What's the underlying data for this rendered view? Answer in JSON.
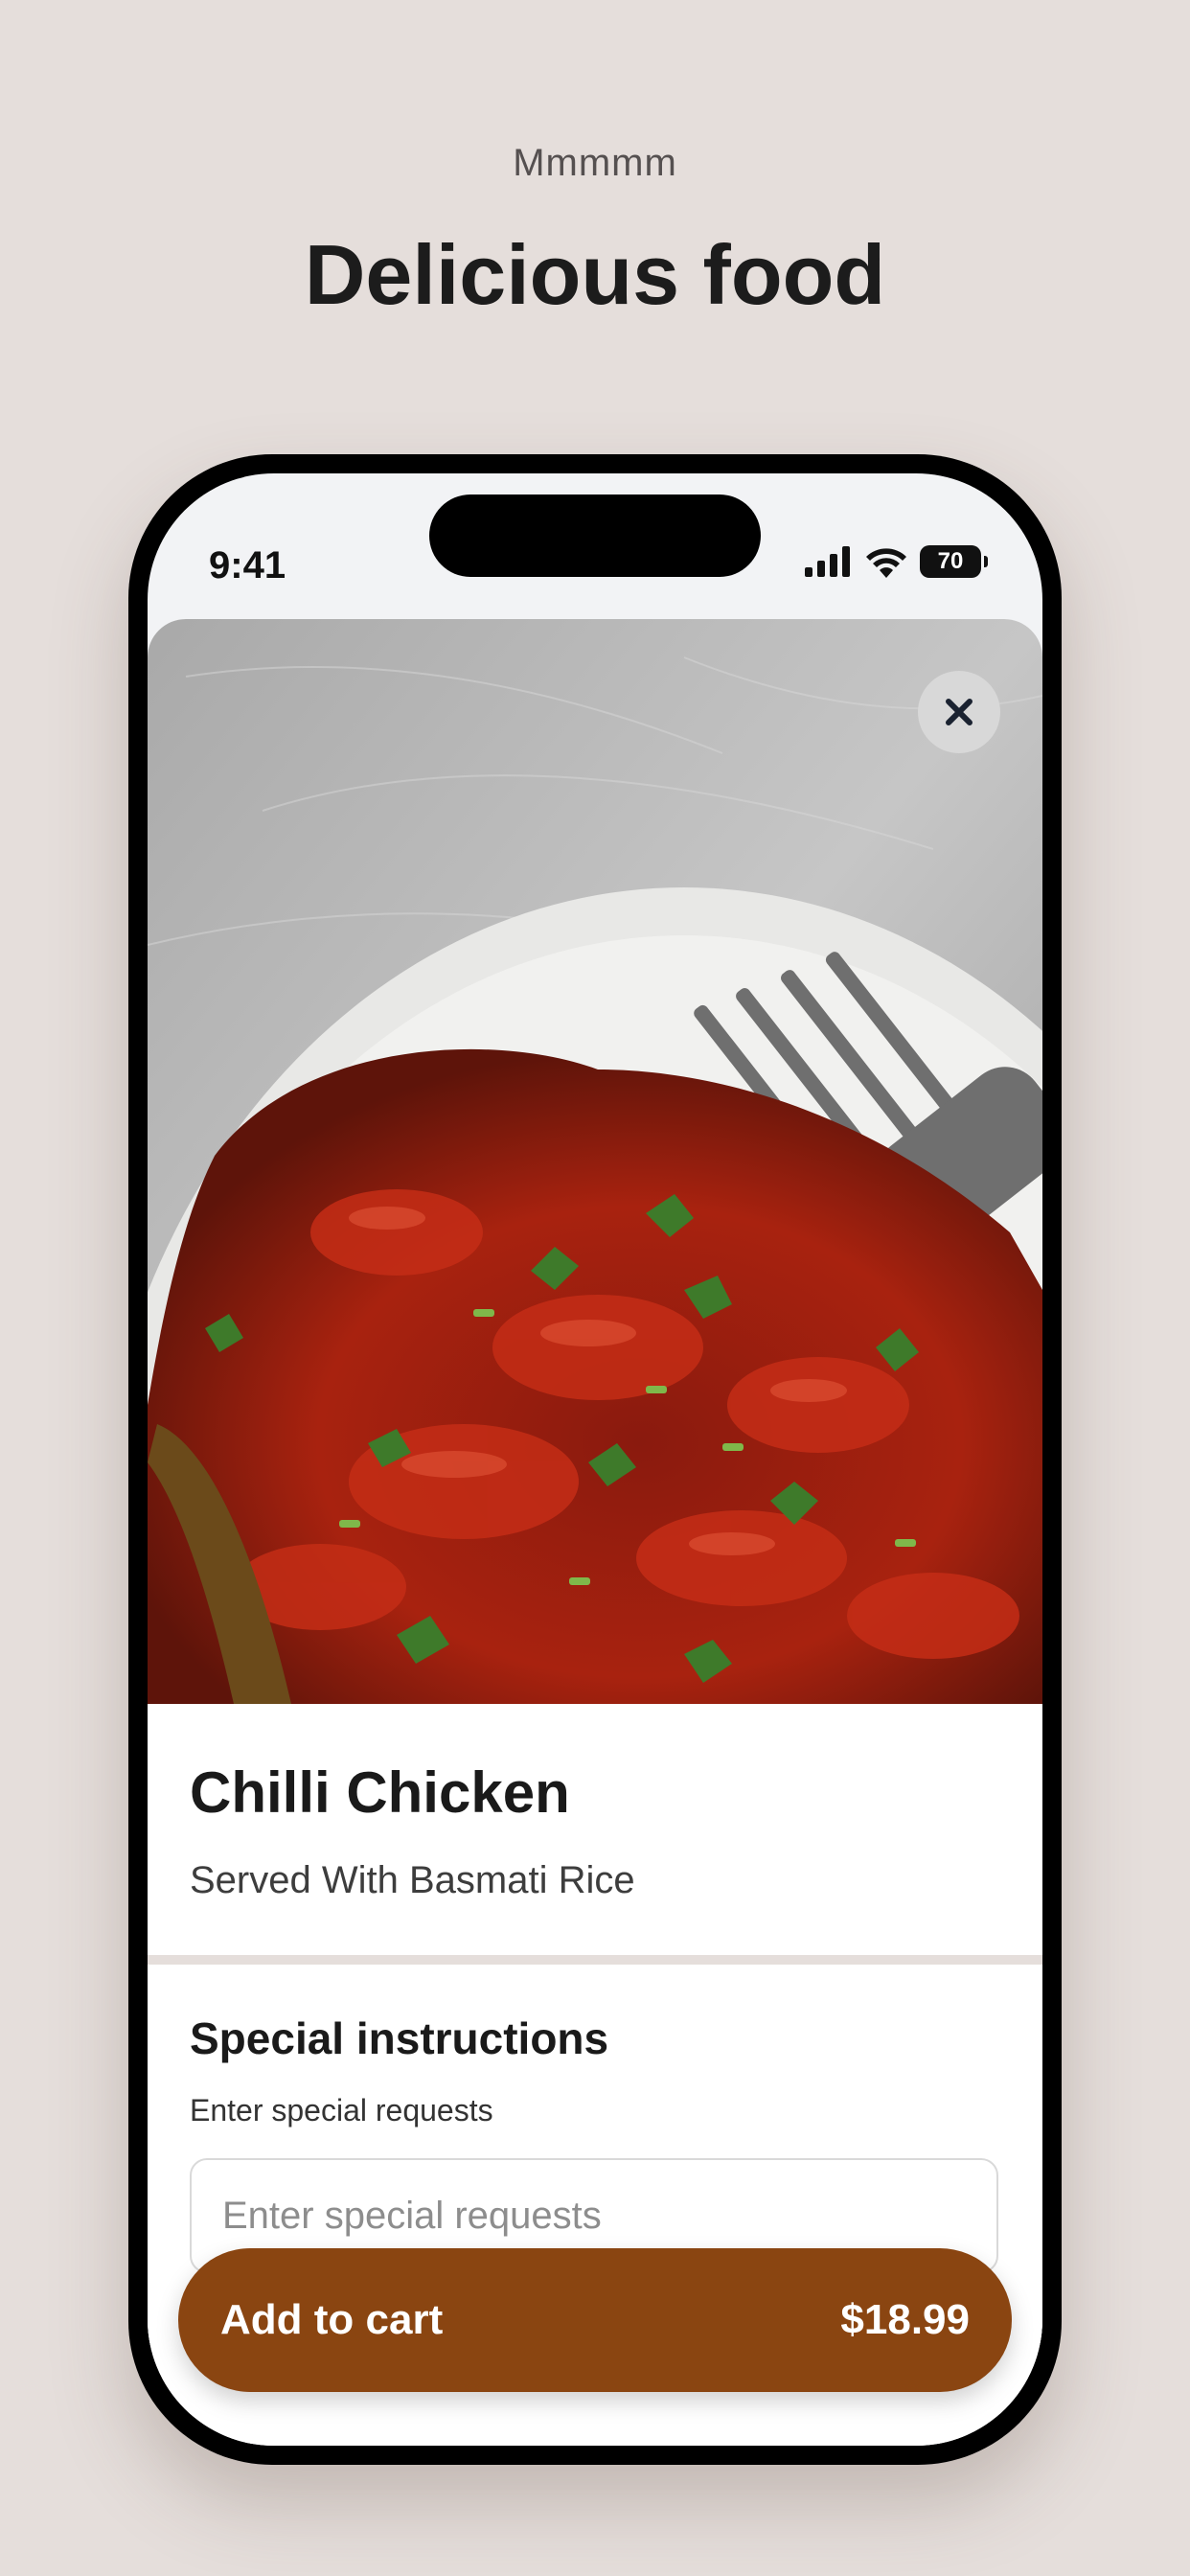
{
  "hero": {
    "eyebrow": "Mmmmm",
    "headline": "Delicious food"
  },
  "status_bar": {
    "time": "9:41",
    "battery": "70",
    "icons": [
      "signal-icon",
      "wifi-icon",
      "battery-icon"
    ]
  },
  "item": {
    "image": "chilli-chicken-photo",
    "title": "Chilli Chicken",
    "subtitle": "Served With Basmati Rice"
  },
  "instructions": {
    "title": "Special instructions",
    "label": "Enter special requests",
    "placeholder": "Enter special requests"
  },
  "cart": {
    "label": "Add to cart",
    "price": "$18.99"
  },
  "colors": {
    "background": "#e5dedb",
    "accent": "#8a4511"
  }
}
